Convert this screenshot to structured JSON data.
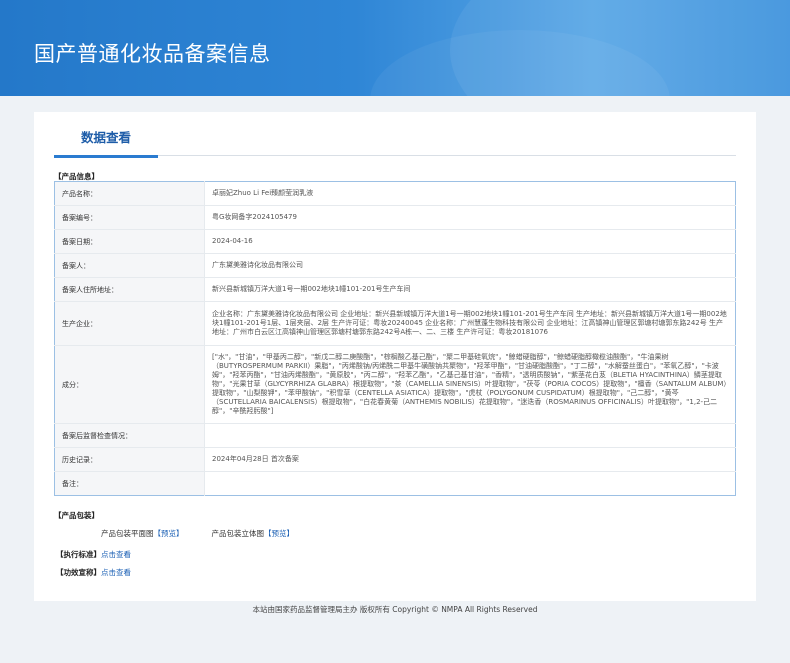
{
  "header": {
    "title": "国产普通化妆品备案信息"
  },
  "tabs": [
    {
      "label": "数据查看"
    }
  ],
  "sections": {
    "product_info": "【产品信息】",
    "packaging": "【产品包装】",
    "standard": "【执行标准】",
    "efficacy": "【功效宣称】"
  },
  "rows": [
    {
      "label": "产品名称：",
      "value": "卓丽妃Zhuo Li Fei臻颜莹润乳液"
    },
    {
      "label": "备案编号：",
      "value": "粤G妆网备字2024105479"
    },
    {
      "label": "备案日期：",
      "value": "2024-04-16"
    },
    {
      "label": "备案人：",
      "value": "广东黛美雅诗化妆品有限公司"
    },
    {
      "label": "备案人住所地址：",
      "value": "新兴县新城镇万洋大道1号一期002地块1幢101-201号生产车间"
    },
    {
      "label": "生产企业：",
      "value": "企业名称：广东黛美雅诗化妆品有限公司 企业地址：新兴县新城镇万洋大道1号一期002地块1幢101-201号生产车间 生产地址：新兴县新城镇万洋大道1号一期002地块1幢101-201号1层、1层夹层、2层 生产许可证：粤妆20240045 企业名称：广州慧蓬生物科技有限公司 企业地址：江高镇神山管理区郭塘村塘郭东路242号 生产地址：广州市白云区江高镇神山管理区郭塘村塘郭东路242号A栋一、二、三楼 生产许可证：粤妆20181076"
    },
    {
      "label": "成分：",
      "value": "[\"水\"，\"甘油\"，\"甲基丙二醇\"，\"新戊二醇二庚酸酯\"，\"棕榈酸乙基己酯\"，\"聚二甲基硅氧烷\"，\"鲸蜡硬脂醇\"，\"鲸蜡硬脂醇橄榄油酸酯\"，\"牛油果树（BUTYROSPERMUM PARKII）果脂\"，\"丙烯酸钠/丙烯酰二甲基牛磺酸钠共聚物\"，\"羟苯甲酯\"，\"甘油硬脂酸酯\"，\"丁二醇\"，\"水解蚕丝蛋白\"，\"苯氧乙醇\"，\"卡波姆\"，\"羟苯丙酯\"，\"甘油丙烯酸酯\"，\"黄原胶\"，\"丙二醇\"，\"羟苯乙酯\"，\"乙基己基甘油\"，\"香精\"，\"透明质酸钠\"，\"紫茎花白芨（BLETIA HYACINTHINA）鳞茎提取物\"，\"光果甘草（GLYCYRRHIZA GLABRA）根提取物\"，\"茶（CAMELLIA SINENSIS）叶提取物\"，\"茯苓（PORIA COCOS）提取物\"，\"檀香（SANTALUM ALBUM）提取物\"，\"山梨酸钾\"，\"苯甲酸钠\"，\"积雪草（CENTELLA ASIATICA）提取物\"，\"虎杖（POLYGONUM CUSPIDATUM）根提取物\"，\"己二醇\"，\"黄芩（SCUTELLARIA BAICALENSIS）根提取物\"，\"白花春黄菊（ANTHEMIS NOBILIS）花提取物\"，\"迷迭香（ROSMARINUS OFFICINALIS）叶提取物\"，\"1,2-己二醇\"，\"辛酰羟肟酸\"]"
    },
    {
      "label": "备案后监督检查情况：",
      "value": ""
    },
    {
      "label": "历史记录：",
      "value": "2024年04月28日 首次备案"
    },
    {
      "label": "备注：",
      "value": ""
    }
  ],
  "packaging": {
    "flat_label": "产品包装平面图",
    "flat_link": "【预览】",
    "solid_label": "产品包装立体图",
    "solid_link": "【预览】"
  },
  "standard_link": "点击查看",
  "efficacy_link": "点击查看",
  "footer": "本站由国家药品监督管理局主办 版权所有 Copyright © NMPA All Rights Reserved"
}
